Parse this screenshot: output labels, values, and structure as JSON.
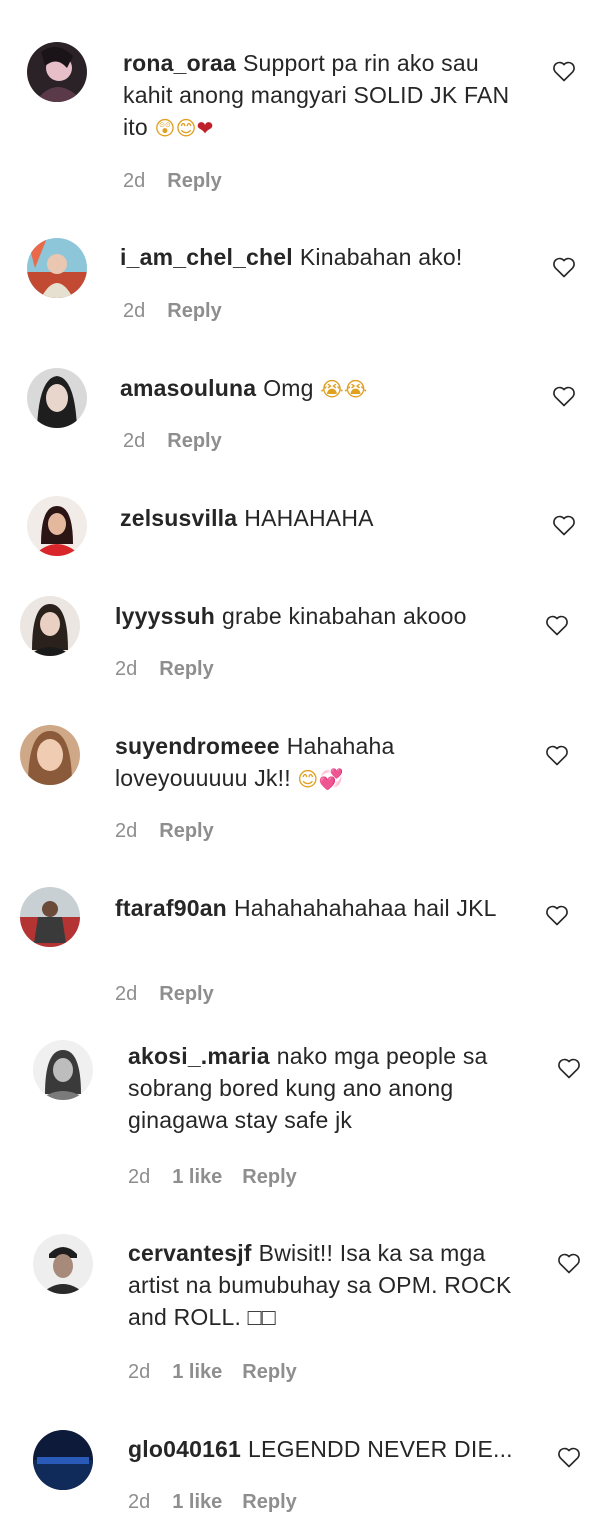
{
  "comments": [
    {
      "username": "rona_oraa",
      "text": "Support pa rin ako sau kahit anong mangyari SOLID JK FAN ito",
      "emoji": "😲😊❤",
      "time": "2d",
      "likes": "",
      "reply": "Reply",
      "avatar_color": "#3a2a33"
    },
    {
      "username": "i_am_chel_chel",
      "text": "Kinabahan ako!",
      "emoji": "",
      "time": "2d",
      "likes": "",
      "reply": "Reply",
      "avatar_color": "#d0614a"
    },
    {
      "username": "amasouluna",
      "text": "Omg",
      "emoji": "😭😭",
      "time": "2d",
      "likes": "",
      "reply": "Reply",
      "avatar_color": "#2a2a2a"
    },
    {
      "username": "zelsusvilla",
      "text": "HAHAHAHA",
      "emoji": "",
      "time": "",
      "likes": "",
      "reply": "",
      "avatar_color": "#c0302a"
    },
    {
      "username": "lyyyssuh",
      "text": "grabe kinabahan akooo",
      "emoji": "",
      "time": "2d",
      "likes": "",
      "reply": "Reply",
      "avatar_color": "#3a302c"
    },
    {
      "username": "suyendromeee",
      "text": "Hahahaha loveyouuuuu Jk!!",
      "emoji": "😊💞",
      "time": "2d",
      "likes": "",
      "reply": "Reply",
      "avatar_color": "#c79a78"
    },
    {
      "username": "ftaraf90an",
      "text": "Hahahahahahaa hail JKL",
      "emoji": "",
      "time": "2d",
      "likes": "",
      "reply": "Reply",
      "avatar_color": "#b23a3a"
    },
    {
      "username": "akosi_.maria",
      "text": "nako mga people sa sobrang bored kung ano anong ginagawa stay safe jk",
      "emoji": "",
      "time": "2d",
      "likes": "1 like",
      "reply": "Reply",
      "avatar_color": "#9a9a9a"
    },
    {
      "username": "cervantesjf",
      "text": "Bwisit!! Isa ka sa mga artist na bumubuhay sa OPM. ROCK and ROLL. □□",
      "emoji": "",
      "time": "2d",
      "likes": "1 like",
      "reply": "Reply",
      "avatar_color": "#3c3c3c"
    },
    {
      "username": "glo040161",
      "text": "LEGENDD NEVER DIE...",
      "emoji": "",
      "time": "2d",
      "likes": "1 like",
      "reply": "Reply",
      "avatar_color": "#1c3a7a"
    }
  ],
  "icons": {
    "like": "heart-outline-icon"
  },
  "colors": {
    "text": "#262626",
    "meta": "#8e8e8e",
    "heart": "#262626",
    "emoji_heart": "#c0202a"
  }
}
